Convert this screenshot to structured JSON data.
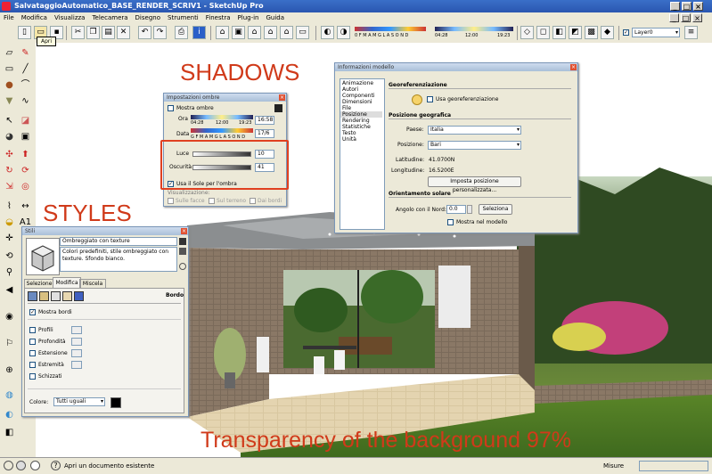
{
  "window": {
    "title": "SalvataggioAutomatico_BASE_RENDER_SCRIV1 - SketchUp Pro"
  },
  "menu": [
    "File",
    "Modifica",
    "Visualizza",
    "Telecamera",
    "Disegno",
    "Strumenti",
    "Finestra",
    "Plug-in",
    "Guida"
  ],
  "tooltip": {
    "label": "Apri"
  },
  "toolbar": {
    "time_scale": "0 F M A M G L A S O N D",
    "time_start": "04:28",
    "time_mid": "12:00",
    "time_end": "19:23",
    "layer_value": "Layer0"
  },
  "overlays": {
    "shadows": "SHADOWS",
    "styles": "STYLES",
    "transparency": "Transparency of the background 97%"
  },
  "shadow_panel": {
    "title": "Impostazioni ombre",
    "show_shadows": "Mostra ombre",
    "time_label": "Ora",
    "time_start": "04:28",
    "time_mid": "12:00",
    "time_end": "19:23",
    "time_value": "16:58",
    "date_label": "Data",
    "date_scale": "G F M A M G L A S O N D",
    "date_value": "17/6",
    "light_label": "Luce",
    "light_value": "10",
    "dark_label": "Oscurità",
    "dark_value": "41",
    "use_sun": "Usa il Sole per l'ombra",
    "display_label": "Visualizzazione:",
    "on_faces": "Sulle facce",
    "on_ground": "Sul terreno",
    "from_edges": "Dai bordi"
  },
  "model_panel": {
    "title": "Informazioni modello",
    "nav": [
      "Animazione",
      "Autori",
      "Componenti",
      "Dimensioni",
      "File",
      "Posizione",
      "Rendering",
      "Statistiche",
      "Testo",
      "Unità"
    ],
    "georef_title": "Georeferenziazione",
    "use_georef": "Usa georeferenziazione",
    "geo_title": "Posizione geografica",
    "country_label": "Paese:",
    "country_value": "Italia",
    "location_label": "Posizione:",
    "location_value": "Bari",
    "lat_label": "Latitudine:",
    "lat_value": "41.0700N",
    "lon_label": "Longitudine:",
    "lon_value": "16.5200E",
    "custom_btn": "Imposta posizione personalizzata...",
    "solar_title": "Orientamento solare",
    "north_label": "Angolo con il Nord:",
    "north_value": "0.0",
    "select_btn": "Seleziona",
    "show_in_model": "Mostra nel modello"
  },
  "styles_panel": {
    "title": "Stili",
    "style_name": "Ombreggiato con texture",
    "style_desc": "Colori predefiniti, stile ombreggiato con texture. Sfondo bianco.",
    "tabs": [
      "Selezione",
      "Modifica",
      "Miscela"
    ],
    "section": "Bordo",
    "show_edges": "Mostra bordi",
    "options": [
      "Profili",
      "Profondità",
      "Estensione",
      "Estremità",
      "Schizzati"
    ],
    "color_label": "Colore:",
    "color_value": "Tutti uguali"
  },
  "status": {
    "hint": "Apri un documento esistente",
    "measure": "Misure"
  },
  "colors": {
    "overlay": "#d03a1a",
    "highlight": "#e04020"
  }
}
